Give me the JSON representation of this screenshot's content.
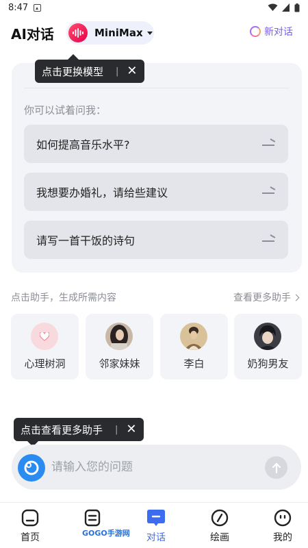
{
  "status_bar": {
    "time": "8:47"
  },
  "header": {
    "title": "AI对话",
    "model_name": "MiniMax",
    "new_chat_label": "新对话"
  },
  "tooltips": {
    "model": "点击更换模型",
    "assistants": "点击查看更多助手",
    "separator": "|",
    "close": "✕"
  },
  "suggestions": {
    "heading": "你可以试着问我：",
    "items": [
      {
        "label": "如何提高音乐水平?"
      },
      {
        "label": "我想要办婚礼，请给些建议"
      },
      {
        "label": "请写一首干饭的诗句"
      }
    ]
  },
  "assistants": {
    "hint": "点击助手，生成所需内容",
    "more_label": "查看更多助手",
    "items": [
      {
        "name": "心理树洞",
        "icon": "heart-icon"
      },
      {
        "name": "邻家妹妹",
        "icon": "girl-avatar"
      },
      {
        "name": "李白",
        "icon": "poet-avatar"
      },
      {
        "name": "奶狗男友",
        "icon": "boy-avatar"
      }
    ]
  },
  "input": {
    "placeholder": "请输入您的问题"
  },
  "nav": [
    {
      "label": "首页",
      "icon": "home-icon"
    },
    {
      "label": "",
      "icon": "document-icon"
    },
    {
      "label": "对话",
      "icon": "chat-icon"
    },
    {
      "label": "绘画",
      "icon": "brush-icon"
    },
    {
      "label": "我的",
      "icon": "profile-icon"
    }
  ],
  "watermark": "GOGO手游网",
  "colors": {
    "accent": "#3c6df0",
    "brand": "#e6004c",
    "tooltip_bg": "#2a2b2e"
  }
}
